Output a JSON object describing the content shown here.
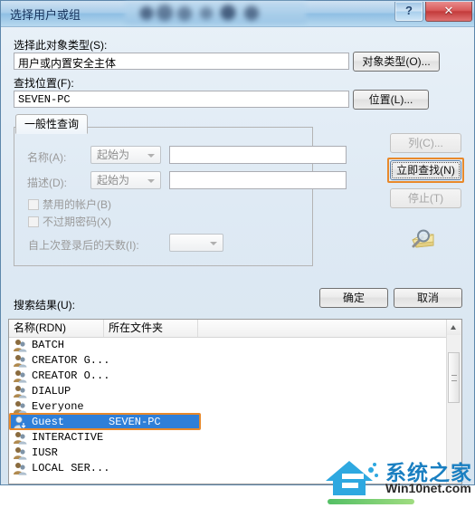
{
  "window": {
    "title": "选择用户或组",
    "help_label": "?",
    "close_label": "✕"
  },
  "object_type": {
    "label": "选择此对象类型(S):",
    "value": "用户或内置安全主体",
    "button_label": "对象类型(O)..."
  },
  "location": {
    "label": "查找位置(F):",
    "value": "SEVEN-PC",
    "button_label": "位置(L)..."
  },
  "query": {
    "tab_label": "一般性查询",
    "name_label": "名称(A):",
    "name_condition": "起始为",
    "name_value": "",
    "desc_label": "描述(D):",
    "desc_condition": "起始为",
    "desc_value": "",
    "disabled_accounts_label": "禁用的帐户(B)",
    "non_expiring_password_label": "不过期密码(X)",
    "days_since_logon_label": "自上次登录后的天数(I):",
    "days_since_logon_value": ""
  },
  "side_buttons": {
    "columns_label": "列(C)...",
    "find_now_label": "立即查找(N)",
    "stop_label": "停止(T)",
    "search_icon": "magnifier-folder-icon"
  },
  "dialog_buttons": {
    "ok_label": "确定",
    "cancel_label": "取消"
  },
  "results": {
    "label": "搜索结果(U):",
    "columns": [
      "名称(RDN)",
      "所在文件夹"
    ],
    "rows": [
      {
        "name": "BATCH",
        "folder": "",
        "selected": false,
        "icon": "group-icon"
      },
      {
        "name": "CREATOR G...",
        "folder": "",
        "selected": false,
        "icon": "group-icon"
      },
      {
        "name": "CREATOR O...",
        "folder": "",
        "selected": false,
        "icon": "group-icon"
      },
      {
        "name": "DIALUP",
        "folder": "",
        "selected": false,
        "icon": "group-icon"
      },
      {
        "name": "Everyone",
        "folder": "",
        "selected": false,
        "icon": "group-icon"
      },
      {
        "name": "Guest",
        "folder": "SEVEN-PC",
        "selected": true,
        "icon": "user-icon"
      },
      {
        "name": "INTERACTIVE",
        "folder": "",
        "selected": false,
        "icon": "group-icon"
      },
      {
        "name": "IUSR",
        "folder": "",
        "selected": false,
        "icon": "group-icon"
      },
      {
        "name": "LOCAL SER...",
        "folder": "",
        "selected": false,
        "icon": "group-icon"
      }
    ]
  },
  "watermark": {
    "cn": "系统之家",
    "en": "Win10net.com"
  },
  "colors": {
    "highlight_box": "#e8892b",
    "selection": "#2f7fd8",
    "title_text": "#15315a",
    "close_button": "#c33b3b"
  }
}
